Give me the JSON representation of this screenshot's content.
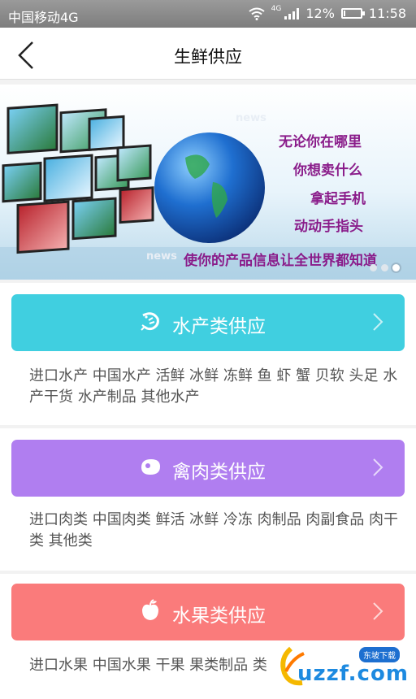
{
  "status_bar": {
    "carrier": "中国移动4G",
    "network_tag": "4G",
    "battery": "12%",
    "battery_level": 0.12,
    "time": "11:58"
  },
  "header": {
    "title": "生鲜供应"
  },
  "banner": {
    "news_label_1": "news",
    "news_label_2": "news",
    "slogans": [
      "无论你在哪里",
      "你想卖什么",
      "拿起手机",
      "动动手指头"
    ],
    "bottom_slogan": "使你的产品信息让全世界都知道",
    "active_dot": 3
  },
  "categories": [
    {
      "label": "水产类供应",
      "icon": "shrimp-icon",
      "color": "#40cfe0",
      "desc": "进口水产 中国水产 活鲜 冰鲜 冻鲜 鱼 虾 蟹 贝软 头足 水产干货 水产制品 其他水产"
    },
    {
      "label": "禽肉类供应",
      "icon": "meat-icon",
      "color": "#b07ef0",
      "desc": "进口肉类 中国肉类 鲜活 冰鲜 冷冻 肉制品 肉副食品 肉干类 其他类"
    },
    {
      "label": "水果类供应",
      "icon": "apple-icon",
      "color": "#fa7b7b",
      "desc": "进口水果 中国水果 干果 果类制品 类"
    }
  ],
  "watermark": {
    "brand": "uzzf.com",
    "tag": "东坡下载"
  }
}
